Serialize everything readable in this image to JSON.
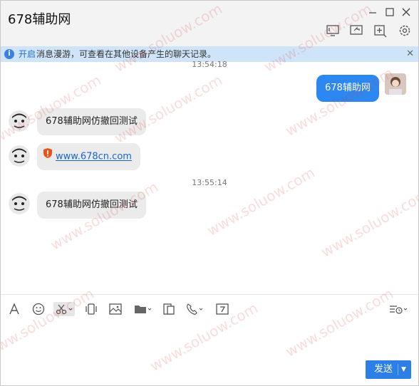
{
  "window": {
    "title": "678辅助网"
  },
  "banner": {
    "link_text": "开启",
    "message": "消息漫游，可查看在其他设备产生的聊天记录。"
  },
  "chat": {
    "timestamp_1": "13:54:18",
    "timestamp_2": "13:55:14",
    "messages": [
      {
        "side": "right",
        "text": "678辅助网"
      },
      {
        "side": "left",
        "text": "678辅助网仿撤回测试"
      },
      {
        "side": "left",
        "text": "www.678cn.com",
        "is_link": true
      },
      {
        "side": "left",
        "text": "678辅助网仿撤回测试"
      }
    ]
  },
  "input": {
    "send_label": "发送"
  },
  "watermark": "www.soluow.com",
  "colors": {
    "accent": "#2d87f0",
    "banner_bg": "#cfe4f8",
    "warning": "#e8541c"
  },
  "icons": [
    "minimize-icon",
    "maximize-icon",
    "close-icon",
    "screen-share-icon",
    "remote-assist-icon",
    "add-member-icon",
    "settings-icon",
    "font-icon",
    "emoji-icon",
    "screenshot-scissors-icon",
    "shake-icon",
    "image-icon",
    "folder-icon",
    "doc-icon",
    "call-icon",
    "calendar-icon",
    "history-icon"
  ]
}
